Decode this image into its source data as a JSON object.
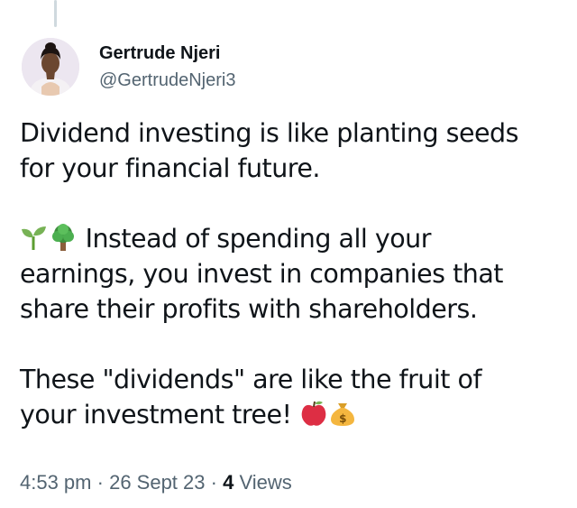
{
  "author": {
    "display_name": "Gertrude Njeri",
    "handle": "@GertrudeNjeri3"
  },
  "tweet": {
    "line1": "Dividend investing is like planting seeds",
    "line2": "for your financial future.",
    "line3": "Instead of spending all your",
    "line4": "earnings, you invest in companies that",
    "line5": "share their profits with shareholders.",
    "line6": "These \"dividends\" are like the fruit of",
    "line7": "your investment tree!",
    "emojis": [
      "seedling-icon",
      "tree-icon",
      "apple-icon",
      "money-bag-icon"
    ]
  },
  "meta": {
    "time": "4:53 pm",
    "separator": "·",
    "date": "26 Sept 23",
    "view_count": "4",
    "views_label": "Views"
  },
  "colors": {
    "text": "#0f1419",
    "muted": "#536471"
  }
}
